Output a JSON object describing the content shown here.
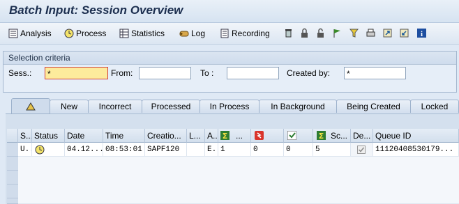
{
  "window": {
    "title": "Batch Input: Session Overview"
  },
  "toolbar": {
    "analysis": "Analysis",
    "process": "Process",
    "statistics": "Statistics",
    "log": "Log",
    "recording": "Recording"
  },
  "selection": {
    "heading": "Selection criteria",
    "sess_label": "Sess.:",
    "sess_value": "*",
    "from_label": "From:",
    "from_value": "",
    "to_label": "To :",
    "to_value": "",
    "created_by_label": "Created by:",
    "created_by_value": "*"
  },
  "tabs": [
    "New",
    "Incorrect",
    "Processed",
    "In Process",
    "In Background",
    "Being Created",
    "Locked"
  ],
  "table": {
    "headers": [
      "S...",
      "Status",
      "Date",
      "Time",
      "Creatio...",
      "L...",
      "A...",
      "...",
      "",
      "",
      "Sc...",
      "De...",
      "Queue ID"
    ],
    "row": {
      "s": "U...",
      "date": "04.12....",
      "time": "08:53:01",
      "creator": "SAPF120",
      "a": "E...",
      "c1": "1",
      "c2": "0",
      "c3": "0",
      "c4": "5",
      "queue_id": "11120408530179..."
    }
  }
}
